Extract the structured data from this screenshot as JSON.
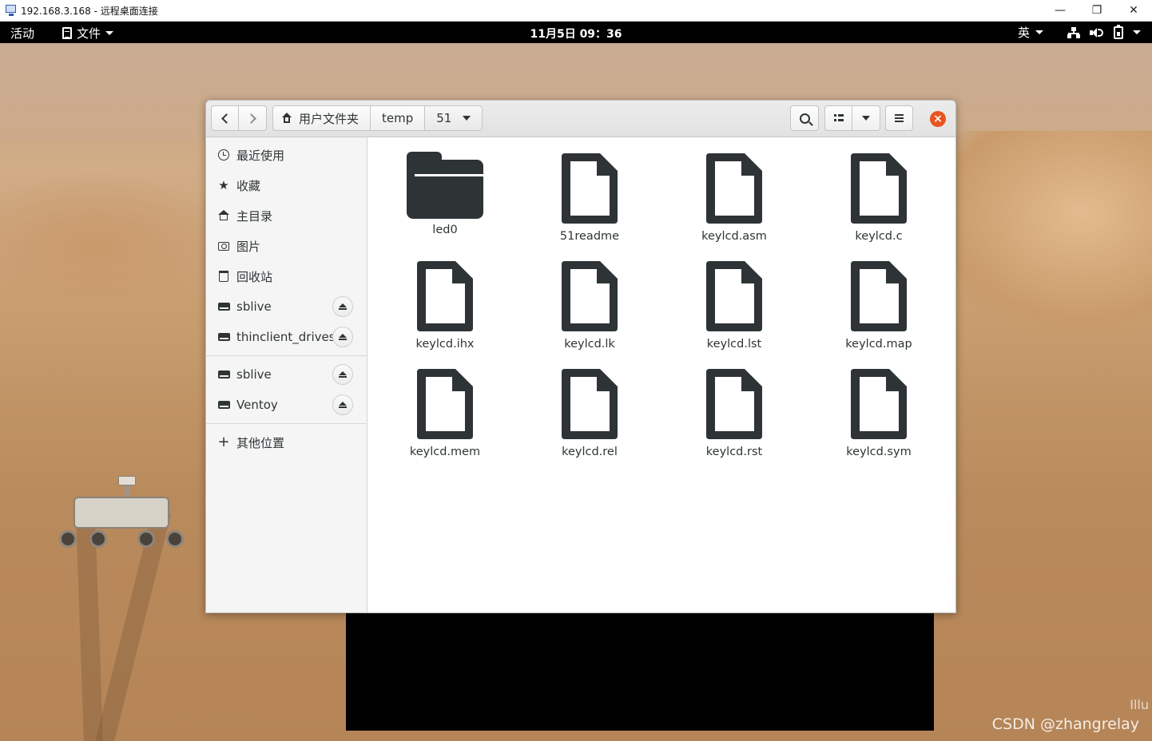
{
  "rdp": {
    "title": "192.168.3.168 - 远程桌面连接",
    "min": "—",
    "restore": "❐",
    "close": "✕"
  },
  "topbar": {
    "activities": "活动",
    "app_menu": "文件",
    "clock": "11月5日  09：36",
    "input_lang": "英"
  },
  "window": {
    "breadcrumbs": [
      "用户文件夹",
      "temp",
      "51"
    ]
  },
  "sidebar": {
    "items": [
      {
        "label": "最近使用",
        "icon": "clock-icon"
      },
      {
        "label": "收藏",
        "icon": "star-icon"
      },
      {
        "label": "主目录",
        "icon": "home-icon"
      },
      {
        "label": "图片",
        "icon": "camera-icon"
      },
      {
        "label": "回收站",
        "icon": "trash-icon"
      },
      {
        "label": "sblive",
        "icon": "drive-icon"
      },
      {
        "label": "thinclient_drives",
        "icon": "drive-icon"
      },
      {
        "label": "sblive",
        "icon": "drive-icon"
      },
      {
        "label": "Ventoy",
        "icon": "drive-icon"
      },
      {
        "label": "其他位置",
        "icon": "plus-icon"
      }
    ]
  },
  "files": [
    {
      "name": "led0",
      "type": "folder"
    },
    {
      "name": "51readme",
      "type": "file"
    },
    {
      "name": "keylcd.asm",
      "type": "file"
    },
    {
      "name": "keylcd.c",
      "type": "file"
    },
    {
      "name": "keylcd.ihx",
      "type": "file"
    },
    {
      "name": "keylcd.lk",
      "type": "file"
    },
    {
      "name": "keylcd.lst",
      "type": "file"
    },
    {
      "name": "keylcd.map",
      "type": "file"
    },
    {
      "name": "keylcd.mem",
      "type": "file"
    },
    {
      "name": "keylcd.rel",
      "type": "file"
    },
    {
      "name": "keylcd.rst",
      "type": "file"
    },
    {
      "name": "keylcd.sym",
      "type": "file"
    }
  ],
  "desktop": {
    "watermark": "CSDN @zhangrelay",
    "corner_text": "Illu"
  },
  "colors": {
    "close_button": "#e95420",
    "icon_dark": "#2e3436"
  }
}
